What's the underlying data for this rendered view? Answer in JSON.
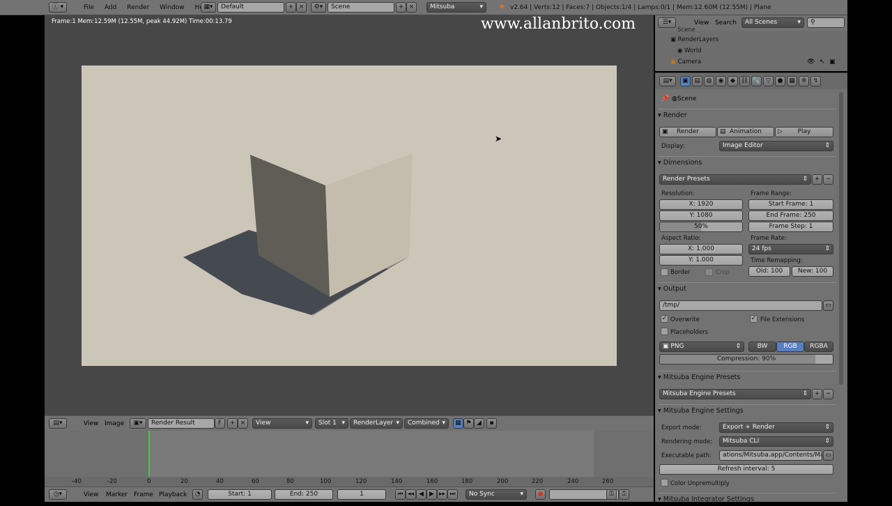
{
  "top_bar": {
    "menus": [
      "File",
      "Add",
      "Render",
      "Window",
      "Help"
    ],
    "layout": "Default",
    "scene": "Scene",
    "engine": "Mitsuba",
    "stats": "v2.64 | Verts:12 | Faces:7 | Objects:1/4 | Lamps:0/1 | Mem:12.60M (12.55M) | Plane"
  },
  "viewer": {
    "status": "Frame:1 Mem:12.59M (12.55M, peak 44.92M) Time:00:13.79",
    "watermark": "www.allanbrito.com"
  },
  "image_header": {
    "view": "View",
    "image": "Image",
    "image_name": "Render Result",
    "f": "F",
    "view_select": "View",
    "slot": "Slot 1",
    "layer": "RenderLayer",
    "pass": "Combined"
  },
  "outliner": {
    "view": "View",
    "search": "Search",
    "filter": "All Scenes",
    "items": [
      "Scene",
      "RenderLayers",
      "World",
      "Camera"
    ]
  },
  "properties": {
    "context": "Scene",
    "render": {
      "title": "Render",
      "render_btn": "Render",
      "animation_btn": "Animation",
      "play_btn": "Play",
      "display_label": "Display:",
      "display_value": "Image Editor"
    },
    "dimensions": {
      "title": "Dimensions",
      "presets": "Render Presets",
      "resolution_label": "Resolution:",
      "res_x": "X: 1920",
      "res_y": "Y: 1080",
      "res_pct": "50%",
      "frame_range_label": "Frame Range:",
      "start": "Start Frame: 1",
      "end": "End Frame: 250",
      "step": "Frame Step: 1",
      "aspect_label": "Aspect Ratio:",
      "asp_x": "X: 1.000",
      "asp_y": "Y: 1.000",
      "frame_rate_label": "Frame Rate:",
      "frame_rate": "24 fps",
      "time_remap_label": "Time Remapping:",
      "old": "Old: 100",
      "new": "New: 100",
      "border": "Border",
      "crop": "Crop"
    },
    "output": {
      "title": "Output",
      "path": "/tmp/",
      "overwrite": "Overwrite",
      "file_ext": "File Extensions",
      "placeholders": "Placeholders",
      "format": "PNG",
      "bw": "BW",
      "rgb": "RGB",
      "rgba": "RGBA",
      "compression": "Compression: 90%"
    },
    "mitsuba_presets": {
      "title": "Mitsuba Engine Presets",
      "value": "Mitsuba Engine Presets"
    },
    "mitsuba_settings": {
      "title": "Mitsuba Engine Settings",
      "export_label": "Export mode:",
      "export_value": "Export + Render",
      "rendering_label": "Rendering mode:",
      "rendering_value": "Mitsuba CLI",
      "exec_label": "Executable path:",
      "exec_value": "ations/Mitsuba.app/Contents/MacOS",
      "refresh": "Refresh interval: 5",
      "unpremultiply": "Color Unpremultiply"
    },
    "integrator": {
      "title": "Mitsuba Integrator Settings"
    }
  },
  "timeline": {
    "ticks": [
      "-40",
      "-20",
      "0",
      "20",
      "40",
      "60",
      "80",
      "100",
      "120",
      "140",
      "160",
      "180",
      "200",
      "220",
      "240",
      "260"
    ],
    "menus": [
      "View",
      "Marker",
      "Frame",
      "Playback"
    ],
    "start": "Start: 1",
    "end": "End: 250",
    "current": "1",
    "sync": "No Sync"
  }
}
